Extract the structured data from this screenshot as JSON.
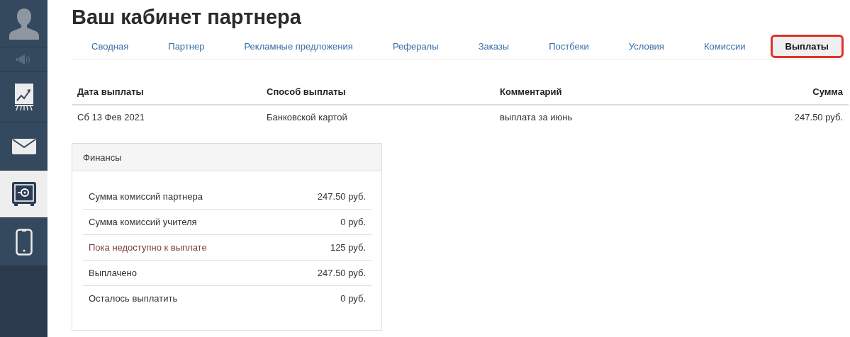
{
  "sidebar": {
    "items": [
      {
        "kind": "avatar",
        "selected": false
      },
      {
        "kind": "megaphone",
        "selected": false
      },
      {
        "kind": "chart",
        "selected": false
      },
      {
        "kind": "mail",
        "selected": false
      },
      {
        "kind": "safe",
        "selected": true
      },
      {
        "kind": "phone",
        "selected": false
      }
    ]
  },
  "title": "Ваш кабинет партнера",
  "tabs": [
    {
      "label": "Сводная",
      "selected": false
    },
    {
      "label": "Партнер",
      "selected": false
    },
    {
      "label": "Рекламные предложения",
      "selected": false
    },
    {
      "label": "Рефералы",
      "selected": false
    },
    {
      "label": "Заказы",
      "selected": false
    },
    {
      "label": "Постбеки",
      "selected": false
    },
    {
      "label": "Условия",
      "selected": false
    },
    {
      "label": "Комиссии",
      "selected": false
    },
    {
      "label": "Выплаты",
      "selected": true
    }
  ],
  "table": {
    "columns": [
      "Дата выплаты",
      "Способ выплаты",
      "Комментарий",
      "Сумма"
    ],
    "rows": [
      [
        "Сб 13 Фев 2021",
        "Банковской картой",
        "выплата за июнь",
        "247.50 руб."
      ]
    ]
  },
  "finances": {
    "title": "Финансы",
    "rows": [
      {
        "label": "Сумма комиссий партнера",
        "value": "247.50 руб.",
        "kind": "normal"
      },
      {
        "label": "Сумма комиссий учителя",
        "value": "0 руб.",
        "kind": "normal"
      },
      {
        "label": "Пока недоступно к выплате",
        "value": "125 руб.",
        "kind": "pending"
      },
      {
        "label": "Выплачено",
        "value": "247.50 руб.",
        "kind": "normal"
      },
      {
        "label": "Осталось выплатить",
        "value": "0 руб.",
        "kind": "normal"
      }
    ]
  }
}
